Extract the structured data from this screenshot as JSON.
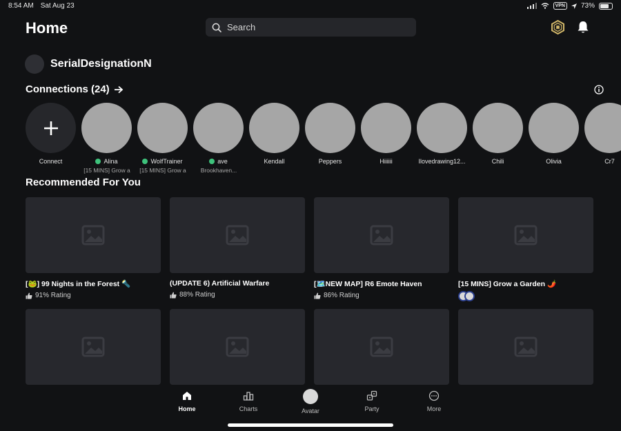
{
  "status_bar": {
    "time": "8:54 AM",
    "date": "Sat Aug 23",
    "vpn": "VPN",
    "battery": "73%",
    "battery_level": 0.73
  },
  "header": {
    "title": "Home",
    "search_placeholder": "Search"
  },
  "profile": {
    "username": "SerialDesignationN"
  },
  "connections": {
    "title": "Connections (24)",
    "connect_label": "Connect",
    "friends": [
      {
        "name": "Alina",
        "online": true,
        "status": "[15 MINS] Grow a"
      },
      {
        "name": "WolfTrainer",
        "online": true,
        "status": "[15 MINS] Grow a"
      },
      {
        "name": "ave",
        "online": true,
        "status": "Brookhaven..."
      },
      {
        "name": "Kendall",
        "online": false,
        "status": ""
      },
      {
        "name": "Peppers",
        "online": false,
        "status": ""
      },
      {
        "name": "Hiiiiii",
        "online": false,
        "status": ""
      },
      {
        "name": "Ilovedrawing12...",
        "online": false,
        "status": ""
      },
      {
        "name": "Chili",
        "online": false,
        "status": ""
      },
      {
        "name": "Olivia",
        "online": false,
        "status": ""
      },
      {
        "name": "Cr7",
        "online": false,
        "status": ""
      }
    ]
  },
  "recommended": {
    "title": "Recommended For You",
    "games": [
      {
        "title": "[🐸] 99 Nights in the Forest 🔦",
        "rating": "91% Rating"
      },
      {
        "title": "(UPDATE 6) Artificial Warfare",
        "rating": "88% Rating"
      },
      {
        "title": "[🗺️NEW MAP] R6 Emote Haven",
        "rating": "86% Rating"
      },
      {
        "title": "[15 MINS] Grow a Garden 🌶️",
        "rating": ""
      },
      {
        "title": "",
        "rating": ""
      },
      {
        "title": "",
        "rating": ""
      },
      {
        "title": "",
        "rating": ""
      },
      {
        "title": "",
        "rating": ""
      }
    ]
  },
  "nav": [
    {
      "label": "Home",
      "icon": "home-icon",
      "active": true
    },
    {
      "label": "Charts",
      "icon": "charts-icon",
      "active": false
    },
    {
      "label": "Avatar",
      "icon": "avatar-icon",
      "active": false
    },
    {
      "label": "Party",
      "icon": "party-icon",
      "active": false
    },
    {
      "label": "More",
      "icon": "more-icon",
      "active": false
    }
  ],
  "colors": {
    "background": "#111214",
    "online": "#3ec27b",
    "robux_gold": "#d4b96a"
  }
}
